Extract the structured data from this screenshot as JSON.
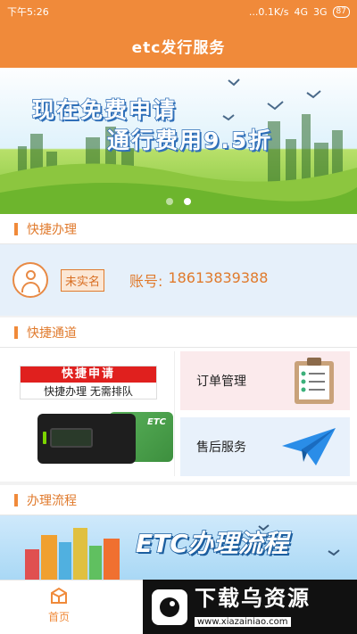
{
  "status_bar": {
    "time": "下午5:26",
    "speed": "...0.1K/s",
    "network1": "4G",
    "network2": "3G",
    "battery": "87"
  },
  "header": {
    "title": "etc发行服务"
  },
  "banner": {
    "line1": "现在免费申请",
    "line2": "通行费用9.5折",
    "slide_count": 2,
    "active_slide": 2
  },
  "sections": {
    "quick_handle": "快捷办理",
    "quick_channel": "快捷通道",
    "process": "办理流程"
  },
  "quick_handle": {
    "badge": "未实名",
    "account_label": "账号:",
    "account_number": "18613839388"
  },
  "channels": {
    "apply_title": "快捷申请",
    "apply_subtitle": "快捷办理  无需排队",
    "device_brand": "ETC",
    "order": "订单管理",
    "after_sales": "售后服务"
  },
  "process_banner": {
    "title": "ETC办理流程"
  },
  "bottom_nav": {
    "home": "首页"
  },
  "watermark": {
    "title": "下载乌资源",
    "url": "www.xiazainiao.com"
  },
  "colors": {
    "brand_orange": "#f08a3a",
    "label_orange": "#e07a2c",
    "apply_red": "#e0201e"
  }
}
